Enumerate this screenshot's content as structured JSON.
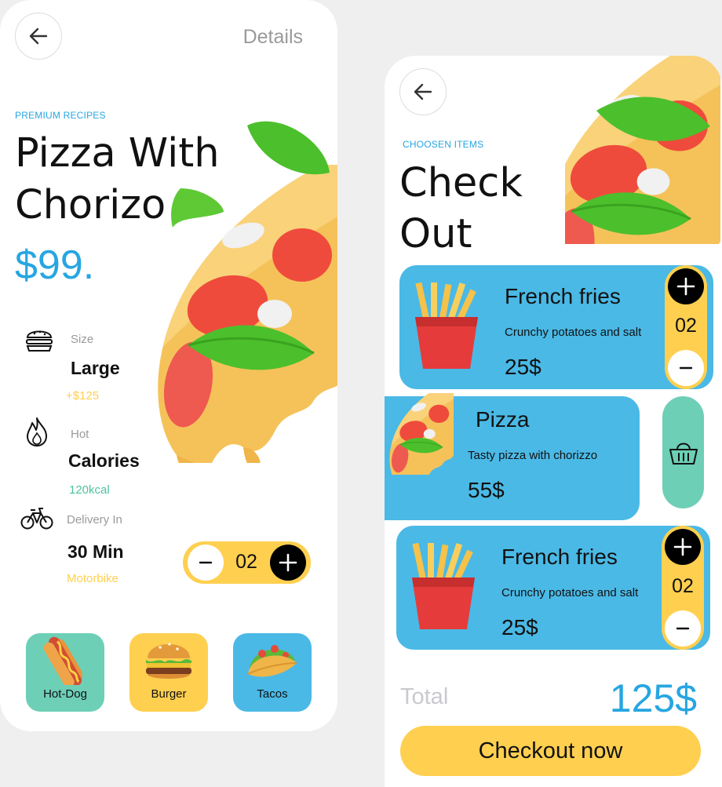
{
  "detail": {
    "header_title": "Details",
    "eyebrow": "PREMIUM RECIPES",
    "title_line1": "Pizza With",
    "title_line2": "Chorizo",
    "price": "$99.",
    "stats": [
      {
        "icon": "burger-icon",
        "label": "Size",
        "value": "Large",
        "sub": "+$125",
        "sub_color": "#ffcf4f"
      },
      {
        "icon": "flame-icon",
        "label": "Hot",
        "value": "Calories",
        "sub": "120kcal",
        "sub_color": "#4fc3a0"
      },
      {
        "icon": "bicycle-icon",
        "label": "Delivery In",
        "value": "30 Min",
        "sub": "Motorbike",
        "sub_color": "#ffcf4f"
      }
    ],
    "quantity": "02",
    "categories": [
      {
        "label": "Hot-Dog",
        "icon": "hotdog-icon",
        "color": "#6dcfb6"
      },
      {
        "label": "Burger",
        "icon": "burger-food-icon",
        "color": "#ffcf4f"
      },
      {
        "label": "Tacos",
        "icon": "taco-icon",
        "color": "#4ab9e6"
      }
    ]
  },
  "checkout": {
    "eyebrow": "CHOOSEN ITEMS",
    "title_line1": "Check",
    "title_line2": "Out",
    "items": [
      {
        "name": "French fries",
        "desc": "Crunchy potatoes and salt",
        "price": "25$",
        "qty": "02",
        "icon": "french-fries-icon"
      },
      {
        "name": "Pizza",
        "desc": "Tasty pizza with chorizzo",
        "price": "55$",
        "icon": "pizza-slice-icon"
      },
      {
        "name": "French fries",
        "desc": "Crunchy potatoes and salt",
        "price": "25$",
        "qty": "02",
        "icon": "french-fries-icon"
      }
    ],
    "total_label": "Total",
    "total_value": "125$",
    "checkout_label": "Checkout now"
  },
  "colors": {
    "accent_blue": "#27a6e1",
    "card_blue": "#4ab9e6",
    "yellow": "#ffcf4f",
    "mint": "#6dcfb6"
  }
}
